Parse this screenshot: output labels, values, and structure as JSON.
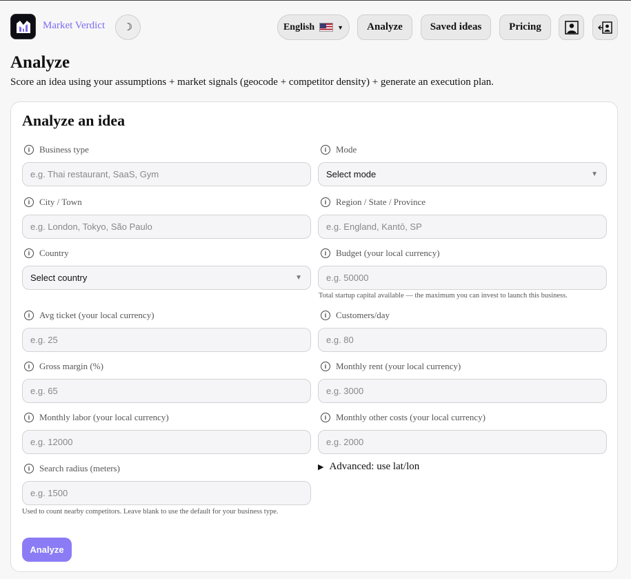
{
  "header": {
    "brand": "Market Verdict",
    "theme_toggle_glyph": "☽",
    "language": "English",
    "nav": {
      "analyze": "Analyze",
      "saved": "Saved ideas",
      "pricing": "Pricing"
    },
    "icons": [
      "logo-icon",
      "moon-icon",
      "us-flag-icon",
      "account-icon",
      "sign-out-icon"
    ]
  },
  "page": {
    "title": "Analyze",
    "subtitle": "Score an idea using your assumptions + market signals (geocode + competitor density) + generate an execution plan."
  },
  "form": {
    "title": "Analyze an idea",
    "fields": {
      "business_type": {
        "label": "Business type",
        "placeholder": "e.g. Thai restaurant, SaaS, Gym"
      },
      "mode": {
        "label": "Mode",
        "value": "Select mode"
      },
      "city": {
        "label": "City / Town",
        "placeholder": "e.g. London, Tokyo, São Paulo"
      },
      "region": {
        "label": "Region / State / Province",
        "placeholder": "e.g. England, Kantō, SP"
      },
      "country": {
        "label": "Country",
        "value": "Select country"
      },
      "budget": {
        "label": "Budget (your local currency)",
        "placeholder": "e.g. 50000",
        "help": "Total startup capital available — the maximum you can invest to launch this business."
      },
      "avg_ticket": {
        "label": "Avg ticket (your local currency)",
        "placeholder": "e.g. 25"
      },
      "customers_day": {
        "label": "Customers/day",
        "placeholder": "e.g. 80"
      },
      "gross_margin": {
        "label": "Gross margin (%)",
        "placeholder": "e.g. 65"
      },
      "monthly_rent": {
        "label": "Monthly rent (your local currency)",
        "placeholder": "e.g. 3000"
      },
      "monthly_labor": {
        "label": "Monthly labor (your local currency)",
        "placeholder": "e.g. 12000"
      },
      "monthly_other": {
        "label": "Monthly other costs (your local currency)",
        "placeholder": "e.g. 2000"
      },
      "search_radius": {
        "label": "Search radius (meters)",
        "placeholder": "e.g. 1500",
        "help": "Used to count nearby competitors. Leave blank to use the default for your business type."
      }
    },
    "advanced": "Advanced: use lat/lon",
    "submit": "Analyze",
    "colors": {
      "accent": "#8b7cf5",
      "brand": "#7b6cf0"
    }
  }
}
